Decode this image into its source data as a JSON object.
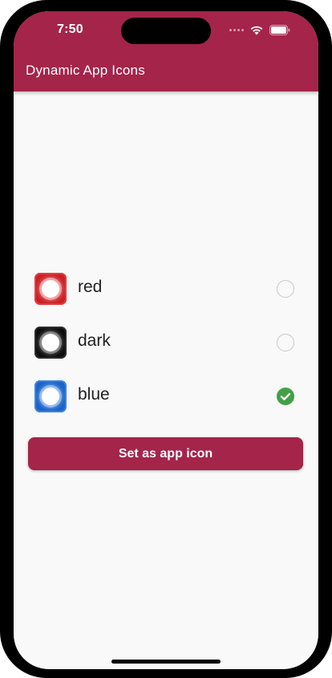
{
  "status_bar": {
    "time": "7:50"
  },
  "app_bar": {
    "title": "Dynamic App Icons",
    "color": "#a4244a"
  },
  "icon_options": [
    {
      "label": "red",
      "icon": "red-app-icon",
      "icon_color": "#cc1f24",
      "selected": false
    },
    {
      "label": "dark",
      "icon": "dark-app-icon",
      "icon_color": "#0d0d0d",
      "selected": false
    },
    {
      "label": "blue",
      "icon": "blue-app-icon",
      "icon_color": "#1a63c9",
      "selected": true
    }
  ],
  "primary_action": {
    "label": "Set as app icon"
  },
  "colors": {
    "accent": "#a4244a",
    "selected_check": "#43a047",
    "unselected_radio": "#c8c8c8",
    "background": "#f9f9f9"
  }
}
